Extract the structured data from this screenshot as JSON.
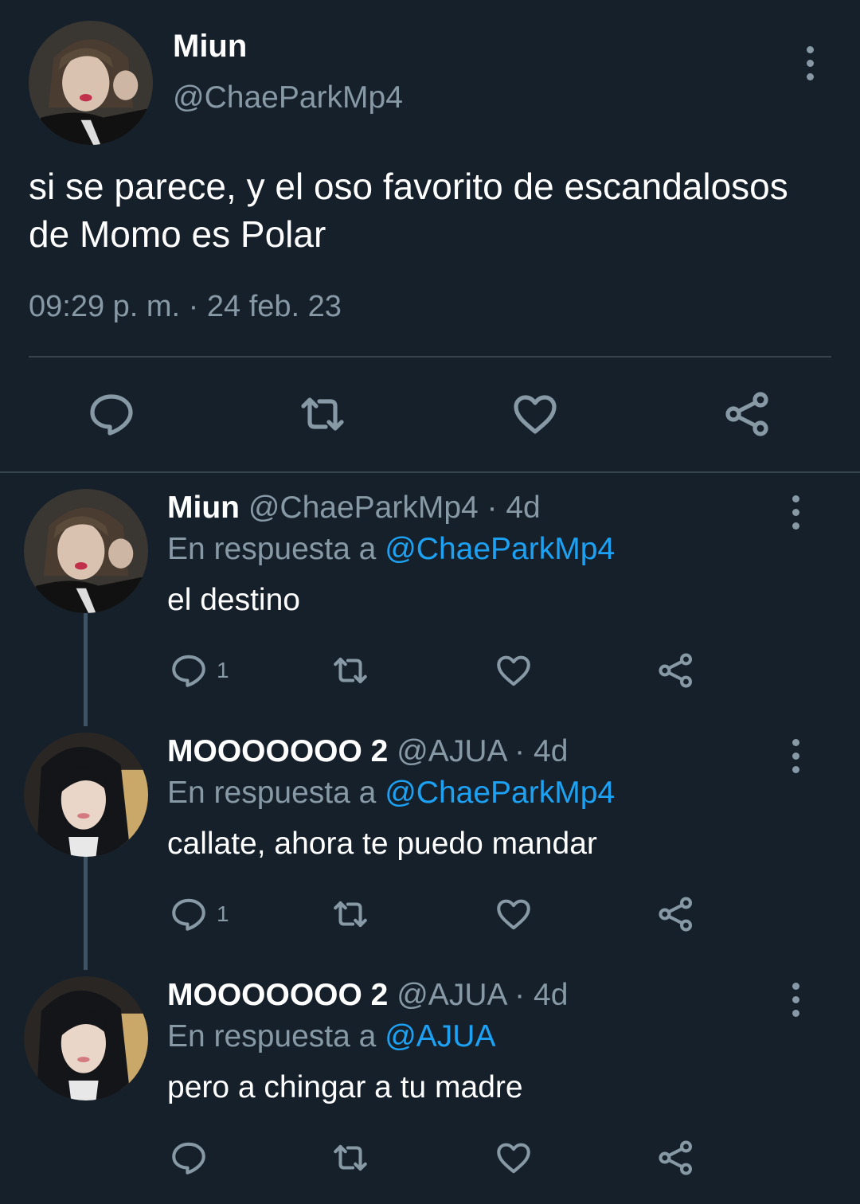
{
  "tweet": {
    "name": "Miun",
    "handle": "@ChaeParkMp4",
    "text": "si se parece, y el oso favorito de escandalosos de Momo es Polar",
    "timestamp": "09:29 p. m. · 24 feb. 23",
    "actions": [
      "reply-icon",
      "retweet-icon",
      "like-icon",
      "share-icon"
    ]
  },
  "replies": [
    {
      "name": "Miun",
      "meta": "@ChaeParkMp4 · 4d",
      "in_reply_prefix": "En respuesta a",
      "in_reply_mention": "@ChaeParkMp4",
      "text": "el destino",
      "reply_count": "1"
    },
    {
      "name": "MOOOOOOO 2",
      "meta": "@AJUA · 4d",
      "in_reply_prefix": "En respuesta a",
      "in_reply_mention": "@ChaeParkMp4",
      "text": "callate, ahora te puedo mandar",
      "reply_count": "1"
    },
    {
      "name": "MOOOOOOO 2",
      "meta": "@AJUA · 4d",
      "in_reply_prefix": "En respuesta a",
      "in_reply_mention": "@AJUA",
      "text": "pero a chingar a tu madre",
      "reply_count": ""
    }
  ],
  "colors": {
    "background": "#15202b",
    "secondary_text": "#8899a6",
    "mention": "#1da1f2",
    "divider": "#38444d"
  }
}
